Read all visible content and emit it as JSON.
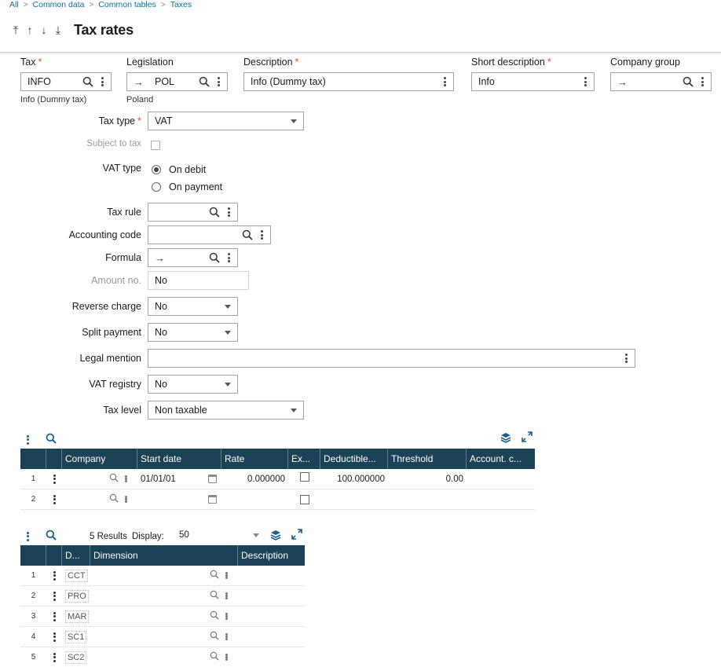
{
  "breadcrumb": [
    "All",
    "Common data",
    "Common tables",
    "Taxes"
  ],
  "title": "Tax rates",
  "nav_icons": [
    "first-record-icon",
    "previous-record-icon",
    "next-record-icon",
    "last-record-icon"
  ],
  "header": {
    "tax": {
      "label": "Tax",
      "value": "INFO",
      "sub": "Info (Dummy tax)"
    },
    "legislation": {
      "label": "Legislation",
      "value": "POL",
      "sub": "Poland"
    },
    "description": {
      "label": "Description",
      "value": "Info (Dummy tax)"
    },
    "short_description": {
      "label": "Short description",
      "value": "Info"
    },
    "company_group": {
      "label": "Company group",
      "value": ""
    }
  },
  "form": {
    "tax_type": {
      "label": "Tax type",
      "value": "VAT"
    },
    "subject_to_tax": {
      "label": "Subject to tax",
      "checked": false
    },
    "vat_type": {
      "label": "VAT type",
      "options": [
        "On debit",
        "On payment"
      ],
      "selected": "On debit"
    },
    "tax_rule": {
      "label": "Tax rule",
      "value": ""
    },
    "accounting_code": {
      "label": "Accounting code",
      "value": ""
    },
    "formula": {
      "label": "Formula",
      "value": ""
    },
    "amount_no": {
      "label": "Amount no.",
      "value": "No"
    },
    "reverse_charge": {
      "label": "Reverse charge",
      "value": "No"
    },
    "split_payment": {
      "label": "Split payment",
      "value": "No"
    },
    "legal_mention": {
      "label": "Legal mention",
      "value": ""
    },
    "vat_registry": {
      "label": "VAT registry",
      "value": "No"
    },
    "tax_level": {
      "label": "Tax level",
      "value": "Non taxable"
    }
  },
  "rates_grid": {
    "columns": [
      "Company",
      "Start date",
      "Rate",
      "Ex...",
      "Deductible...",
      "Threshold",
      "Account. c..."
    ],
    "rows": [
      {
        "num": "1",
        "company": "",
        "start_date": "01/01/01",
        "rate": "0.000000",
        "exempt": false,
        "deductible": "100.000000",
        "threshold": "0.00",
        "account": ""
      },
      {
        "num": "2",
        "company": "",
        "start_date": "",
        "rate": "",
        "exempt": false,
        "deductible": "",
        "threshold": "",
        "account": ""
      }
    ]
  },
  "dims_grid": {
    "results": "5 Results",
    "display_label": "Display:",
    "display_value": "50",
    "columns": [
      "D...",
      "Dimension",
      "Description"
    ],
    "rows": [
      {
        "num": "1",
        "code": "CCT"
      },
      {
        "num": "2",
        "code": "PRO"
      },
      {
        "num": "3",
        "code": "MAR"
      },
      {
        "num": "4",
        "code": "SC1"
      },
      {
        "num": "5",
        "code": "SC2"
      }
    ]
  },
  "colors": {
    "header_bg": "#1c4257",
    "accent": "#1d5f8a",
    "required": "#e0501f",
    "link": "#0a6ea7"
  }
}
